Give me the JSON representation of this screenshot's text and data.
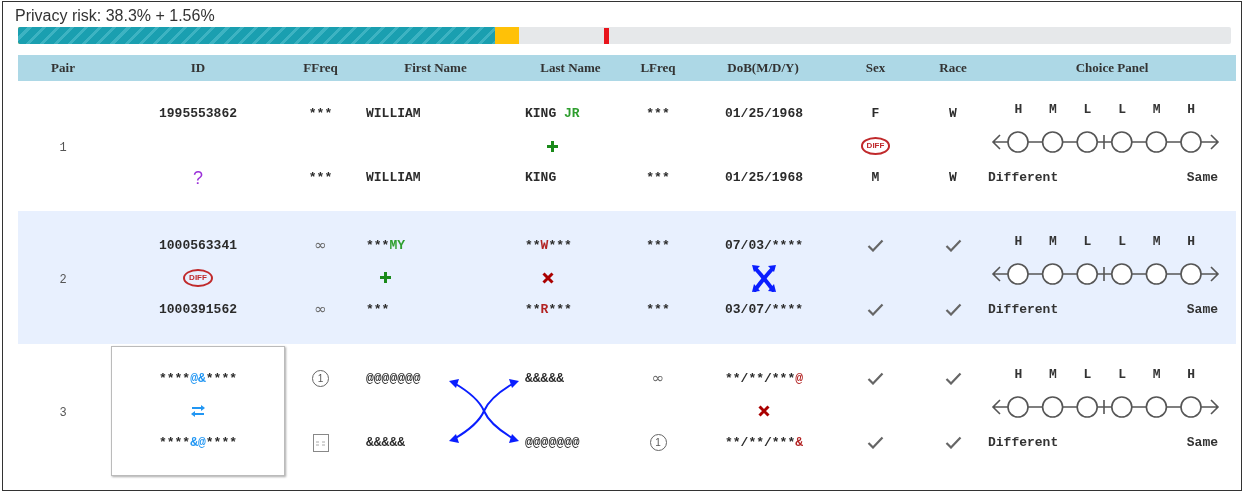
{
  "risk": {
    "label": "Privacy risk: 38.3% + 1.56%",
    "segments": [
      {
        "kind": "risk",
        "level": 0.393
      },
      {
        "kind": "added",
        "level": 0.4127
      }
    ],
    "marker": {
      "level": 0.483
    }
  },
  "table": {
    "columns": [
      "Pair",
      "ID",
      "FFreq",
      "First Name",
      "Last Name",
      "LFreq",
      "DoB(M/D/Y)",
      "Sex",
      "Race",
      "Choice Panel"
    ],
    "rows": [
      {
        "pair": "1",
        "highlighted": false,
        "cells": {
          "id": {
            "top": {
              "kind": "text",
              "segments": [
                {
                  "text": "1995553862",
                  "kind": "same"
                }
              ]
            },
            "bottom": {
              "kind": "text",
              "segments": [
                {
                  "text": "?",
                  "kind": "unknown"
                }
              ]
            }
          },
          "ffreq": {
            "top": {
              "kind": "text",
              "segments": [
                {
                  "text": "***",
                  "kind": "same"
                }
              ]
            },
            "bottom": {
              "kind": "text",
              "segments": [
                {
                  "text": "***",
                  "kind": "same"
                }
              ]
            }
          },
          "first_name": {
            "top": {
              "kind": "text",
              "segments": [
                {
                  "text": "WILLIAM",
                  "kind": "same"
                }
              ]
            },
            "bottom": {
              "kind": "text",
              "segments": [
                {
                  "text": "WILLIAM",
                  "kind": "same"
                }
              ]
            }
          },
          "last_name": {
            "top": {
              "kind": "text",
              "segments": [
                {
                  "text": "KING ",
                  "kind": "same"
                },
                {
                  "text": "JR",
                  "kind": "added"
                }
              ]
            },
            "mark": {
              "kind": "plus"
            },
            "bottom": {
              "kind": "text",
              "segments": [
                {
                  "text": "KING",
                  "kind": "same"
                }
              ]
            }
          },
          "lfreq": {
            "top": {
              "kind": "text",
              "segments": [
                {
                  "text": "***",
                  "kind": "same"
                }
              ]
            },
            "bottom": {
              "kind": "text",
              "segments": [
                {
                  "text": "***",
                  "kind": "same"
                }
              ]
            }
          },
          "dob": {
            "top": {
              "kind": "text",
              "segments": [
                {
                  "text": "01/25/1968",
                  "kind": "same"
                }
              ]
            },
            "bottom": {
              "kind": "text",
              "segments": [
                {
                  "text": "01/25/1968",
                  "kind": "same"
                }
              ]
            }
          },
          "sex": {
            "top": {
              "kind": "text",
              "segments": [
                {
                  "text": "F",
                  "kind": "same"
                }
              ]
            },
            "mark": {
              "kind": "diff",
              "text": "DIFF"
            },
            "bottom": {
              "kind": "text",
              "segments": [
                {
                  "text": "M",
                  "kind": "same"
                }
              ]
            }
          },
          "race": {
            "top": {
              "kind": "text",
              "segments": [
                {
                  "text": "W",
                  "kind": "same"
                }
              ]
            },
            "bottom": {
              "kind": "text",
              "segments": [
                {
                  "text": "W",
                  "kind": "same"
                }
              ]
            }
          }
        },
        "choice": {
          "levels": [
            "H",
            "M",
            "L",
            "L",
            "M",
            "H"
          ],
          "options": [
            {
              "selected": false
            },
            {
              "selected": false
            },
            {
              "selected": false
            },
            {
              "selected": false
            },
            {
              "selected": false
            },
            {
              "selected": false
            }
          ],
          "left": "Different",
          "right": "Same"
        }
      },
      {
        "pair": "2",
        "highlighted": true,
        "cells": {
          "id": {
            "top": {
              "kind": "text",
              "segments": [
                {
                  "text": "1000563341",
                  "kind": "same"
                }
              ]
            },
            "mark": {
              "kind": "diff",
              "text": "DIFF"
            },
            "bottom": {
              "kind": "text",
              "segments": [
                {
                  "text": "1000391562",
                  "kind": "same"
                }
              ]
            }
          },
          "ffreq": {
            "top": {
              "kind": "symbol",
              "text": "∞"
            },
            "bottom": {
              "kind": "symbol",
              "text": "∞"
            }
          },
          "first_name": {
            "top": {
              "kind": "text",
              "segments": [
                {
                  "text": "***",
                  "kind": "same"
                },
                {
                  "text": "MY",
                  "kind": "added"
                }
              ]
            },
            "mark": {
              "kind": "plus"
            },
            "bottom": {
              "kind": "text",
              "segments": [
                {
                  "text": "***",
                  "kind": "same"
                }
              ]
            }
          },
          "last_name": {
            "top": {
              "kind": "text",
              "segments": [
                {
                  "text": "**",
                  "kind": "same"
                },
                {
                  "text": "W",
                  "kind": "changed"
                },
                {
                  "text": "***",
                  "kind": "same"
                }
              ]
            },
            "mark": {
              "kind": "cross"
            },
            "bottom": {
              "kind": "text",
              "segments": [
                {
                  "text": "**",
                  "kind": "same"
                },
                {
                  "text": "R",
                  "kind": "changed"
                },
                {
                  "text": "***",
                  "kind": "same"
                }
              ]
            }
          },
          "lfreq": {
            "top": {
              "kind": "text",
              "segments": [
                {
                  "text": "***",
                  "kind": "same"
                }
              ]
            },
            "bottom": {
              "kind": "text",
              "segments": [
                {
                  "text": "***",
                  "kind": "same"
                }
              ]
            }
          },
          "dob": {
            "top": {
              "kind": "text",
              "segments": [
                {
                  "text": "07/03/****",
                  "kind": "same"
                }
              ]
            },
            "mark": {
              "kind": "swap"
            },
            "bottom": {
              "kind": "text",
              "segments": [
                {
                  "text": "03/07/****",
                  "kind": "same"
                }
              ]
            }
          },
          "sex": {
            "top": {
              "kind": "check"
            },
            "bottom": {
              "kind": "check"
            }
          },
          "race": {
            "top": {
              "kind": "check"
            },
            "bottom": {
              "kind": "check"
            }
          }
        },
        "choice": {
          "levels": [
            "H",
            "M",
            "L",
            "L",
            "M",
            "H"
          ],
          "options": [
            {
              "selected": false
            },
            {
              "selected": false
            },
            {
              "selected": false
            },
            {
              "selected": false
            },
            {
              "selected": false
            },
            {
              "selected": false
            }
          ],
          "left": "Different",
          "right": "Same"
        }
      },
      {
        "pair": "3",
        "highlighted": false,
        "cells": {
          "id": {
            "boxed": true,
            "top": {
              "kind": "text",
              "segments": [
                {
                  "text": "****",
                  "kind": "same"
                },
                {
                  "text": "@&",
                  "kind": "moved"
                },
                {
                  "text": "****",
                  "kind": "same"
                }
              ]
            },
            "mark": {
              "kind": "transpose"
            },
            "bottom": {
              "kind": "text",
              "segments": [
                {
                  "text": "****",
                  "kind": "same"
                },
                {
                  "text": "&@",
                  "kind": "moved"
                },
                {
                  "text": "****",
                  "kind": "same"
                }
              ]
            }
          },
          "ffreq": {
            "top": {
              "kind": "circled",
              "text": "1"
            },
            "bottom": {
              "kind": "calendar"
            }
          },
          "first_name": {
            "top": {
              "kind": "text",
              "segments": [
                {
                  "text": "@@@@@@@",
                  "kind": "same"
                }
              ]
            },
            "mark": {
              "kind": "crossing"
            },
            "bottom": {
              "kind": "text",
              "segments": [
                {
                  "text": "&&&&&",
                  "kind": "same"
                }
              ]
            }
          },
          "last_name": {
            "top": {
              "kind": "text",
              "segments": [
                {
                  "text": "&&&&&",
                  "kind": "same"
                }
              ]
            },
            "bottom": {
              "kind": "text",
              "segments": [
                {
                  "text": "@@@@@@@",
                  "kind": "same"
                }
              ]
            }
          },
          "lfreq": {
            "top": {
              "kind": "symbol",
              "text": "∞"
            },
            "bottom": {
              "kind": "circled",
              "text": "1"
            }
          },
          "dob": {
            "top": {
              "kind": "text",
              "segments": [
                {
                  "text": "**/**/***",
                  "kind": "same"
                },
                {
                  "text": "@",
                  "kind": "changed"
                }
              ]
            },
            "mark": {
              "kind": "cross"
            },
            "bottom": {
              "kind": "text",
              "segments": [
                {
                  "text": "**/**/***",
                  "kind": "same"
                },
                {
                  "text": "&",
                  "kind": "changed"
                }
              ]
            }
          },
          "sex": {
            "top": {
              "kind": "check"
            },
            "bottom": {
              "kind": "check"
            }
          },
          "race": {
            "top": {
              "kind": "check"
            },
            "bottom": {
              "kind": "check"
            }
          }
        },
        "choice": {
          "levels": [
            "H",
            "M",
            "L",
            "L",
            "M",
            "H"
          ],
          "options": [
            {
              "selected": false
            },
            {
              "selected": false
            },
            {
              "selected": false
            },
            {
              "selected": false
            },
            {
              "selected": false
            },
            {
              "selected": false
            }
          ],
          "left": "Different",
          "right": "Same"
        }
      }
    ]
  }
}
